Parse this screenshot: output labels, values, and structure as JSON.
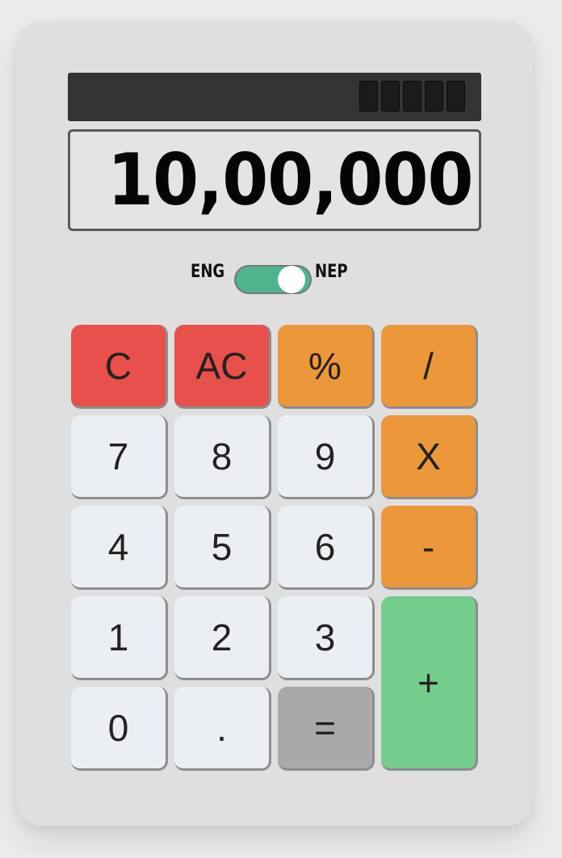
{
  "display": {
    "solar_cells": 5,
    "value": "10,00,000"
  },
  "language_toggle": {
    "left_label": "ENG",
    "right_label": "NEP",
    "selected": "NEP"
  },
  "keys": {
    "clear": "C",
    "all_clear": "AC",
    "percent": "%",
    "divide": "/",
    "seven": "7",
    "eight": "8",
    "nine": "9",
    "multiply": "X",
    "four": "4",
    "five": "5",
    "six": "6",
    "minus": "-",
    "one": "1",
    "two": "2",
    "three": "3",
    "plus": "+",
    "zero": "0",
    "decimal": ".",
    "equals": "="
  },
  "colors": {
    "clear_keys": "#e8504b",
    "operator_keys": "#ec9739",
    "digit_keys": "#ebeff3",
    "equals_key": "#a9a9a9",
    "plus_key": "#74cd8d",
    "toggle": "#4fb48e"
  }
}
